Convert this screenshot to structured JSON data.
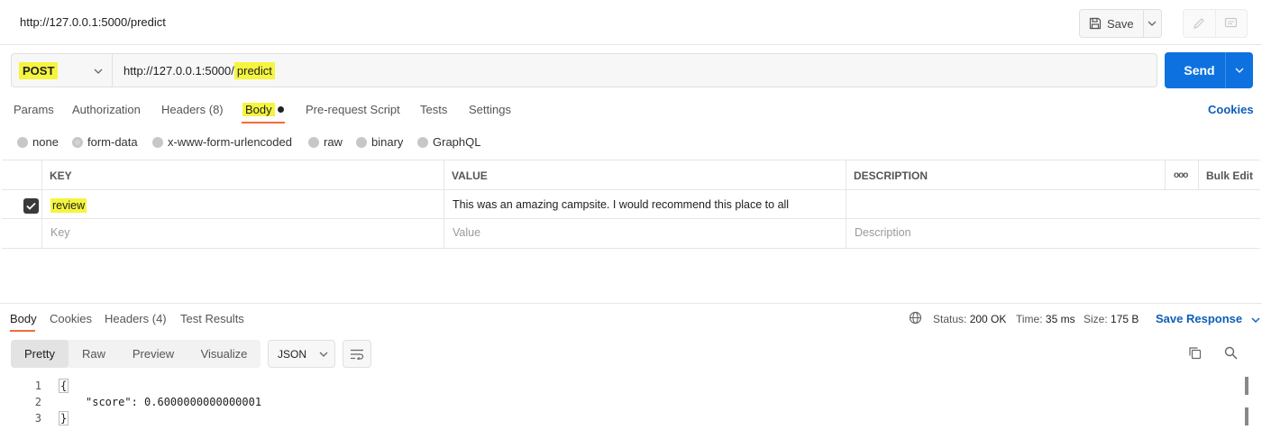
{
  "topbar": {
    "title": "http://127.0.0.1:5000/predict",
    "save_label": "Save"
  },
  "request": {
    "method": "POST",
    "url_prefix": "http://127.0.0.1:5000/",
    "url_path": "predict",
    "send_label": "Send"
  },
  "request_tabs": {
    "params": "Params",
    "authorization": "Authorization",
    "headers": "Headers (8)",
    "body": "Body",
    "prerequest": "Pre-request Script",
    "tests": "Tests",
    "settings": "Settings",
    "cookies": "Cookies"
  },
  "body_types": {
    "none": "none",
    "form_data": "form-data",
    "urlencoded": "x-www-form-urlencoded",
    "raw": "raw",
    "binary": "binary",
    "graphql": "GraphQL",
    "selected": "form-data"
  },
  "params_table": {
    "headers": {
      "key": "KEY",
      "value": "VALUE",
      "description": "DESCRIPTION",
      "more": "ooo",
      "bulk_edit": "Bulk Edit"
    },
    "rows": [
      {
        "checked": true,
        "key": "review",
        "value": "This was an amazing campsite. I would recommend this place to all",
        "description": ""
      }
    ],
    "placeholder": {
      "key": "Key",
      "value": "Value",
      "description": "Description"
    }
  },
  "response_tabs": {
    "body": "Body",
    "cookies": "Cookies",
    "headers": "Headers (4)",
    "test_results": "Test Results"
  },
  "response_meta": {
    "status_label": "Status:",
    "status_value": "200 OK",
    "time_label": "Time:",
    "time_value": "35 ms",
    "size_label": "Size:",
    "size_value": "175 B",
    "save_response": "Save Response"
  },
  "response_view": {
    "modes": {
      "pretty": "Pretty",
      "raw": "Raw",
      "preview": "Preview",
      "visualize": "Visualize"
    },
    "active": "Pretty",
    "format": "JSON"
  },
  "code_lines": [
    {
      "num": "1",
      "text": "{"
    },
    {
      "num": "2",
      "text": "\"score\": 0.6000000000000001"
    },
    {
      "num": "3",
      "text": "}"
    }
  ],
  "colors": {
    "accent": "#0d72e0",
    "highlight": "#f5f53f",
    "tab_underline": "#f26b3a",
    "link": "#0d5fb8"
  },
  "icons": [
    "save-icon",
    "chevron-down-icon",
    "pencil-icon",
    "comment-icon",
    "globe-icon",
    "wrap-lines-icon",
    "copy-icon",
    "search-icon",
    "checkbox-checked-icon"
  ]
}
